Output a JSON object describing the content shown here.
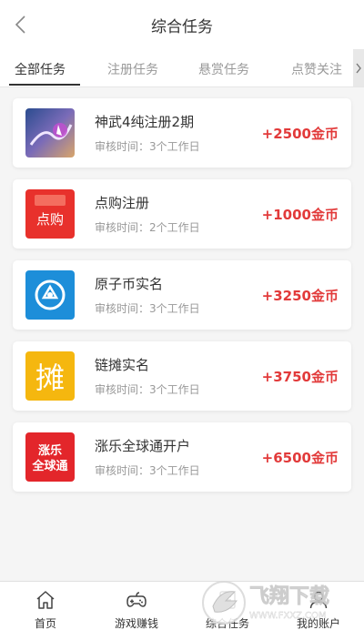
{
  "header": {
    "title": "综合任务",
    "back_icon": "chevron-left-icon"
  },
  "tabs": [
    {
      "label": "全部任务",
      "active": true
    },
    {
      "label": "注册任务",
      "active": false
    },
    {
      "label": "悬赏任务",
      "active": false
    },
    {
      "label": "点赞关注",
      "active": false
    }
  ],
  "tasks": [
    {
      "name": "神武4纯注册2期",
      "review": "审核时间：3个工作日",
      "reward": "+2500金币",
      "icon": "shenwu-game-icon"
    },
    {
      "name": "点购注册",
      "review": "审核时间：2个工作日",
      "reward": "+1000金币",
      "icon": "diangou-icon",
      "icon_text": "点购"
    },
    {
      "name": "原子币实名",
      "review": "审核时间：3个工作日",
      "reward": "+3250金币",
      "icon": "yuanzibi-icon"
    },
    {
      "name": "链摊实名",
      "review": "审核时间：3个工作日",
      "reward": "+3750金币",
      "icon": "liantan-icon",
      "icon_text": "摊"
    },
    {
      "name": "涨乐全球通开户",
      "review": "审核时间：3个工作日",
      "reward": "+6500金币",
      "icon": "zhangle-icon",
      "icon_text": [
        "涨乐",
        "全球通"
      ]
    }
  ],
  "bottom_nav": [
    {
      "label": "首页",
      "icon": "home-icon"
    },
    {
      "label": "游戏赚钱",
      "icon": "gamepad-icon"
    },
    {
      "label": "综合任务",
      "icon": "tasks-icon"
    },
    {
      "label": "我的账户",
      "icon": "account-icon"
    }
  ],
  "watermark": {
    "text": "飞翔下载",
    "url_text": "WWW.FXXZ.COM"
  },
  "colors": {
    "reward": "#e23a3a",
    "accent_dark": "#333333",
    "muted": "#999999"
  }
}
